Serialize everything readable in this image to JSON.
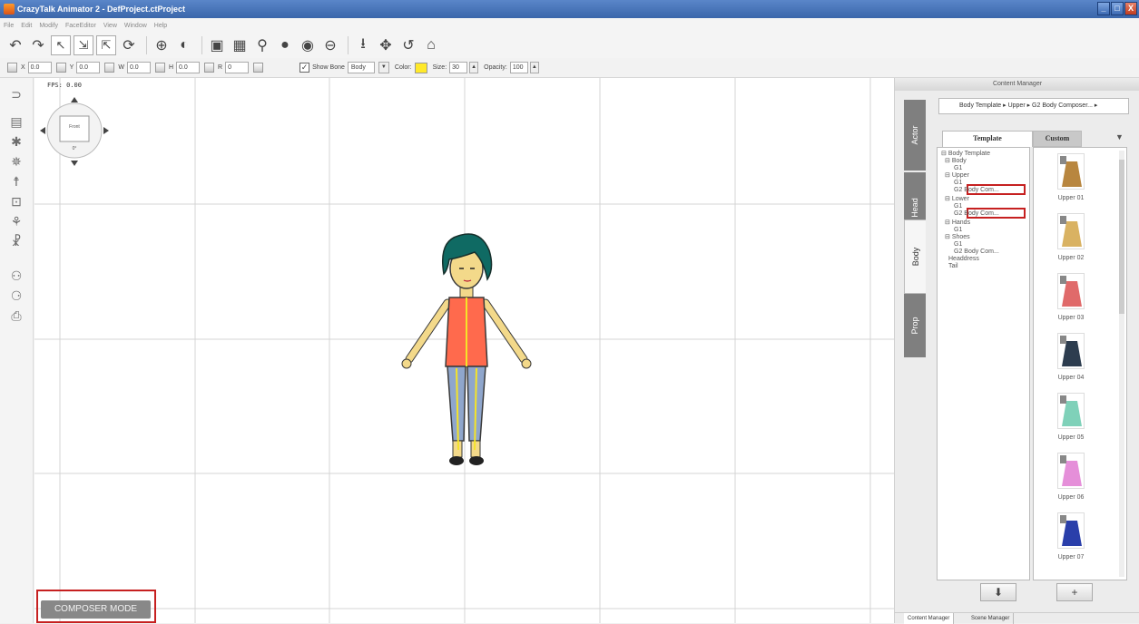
{
  "window": {
    "title": "CrazyTalk Animator 2 - DefProject.ctProject",
    "buttons": [
      "_",
      "□",
      "X"
    ]
  },
  "menu": [
    "File",
    "Edit",
    "Modify",
    "FaceEditor",
    "View",
    "Window",
    "Help"
  ],
  "toolbar": {
    "icons": [
      "undo-icon",
      "redo-icon",
      "select-icon",
      "multi-select-icon",
      "bone-select-icon",
      "rotate-icon",
      "add-actor-icon",
      "add-prop-icon",
      "stage-icon",
      "scene-icon",
      "puppet-icon",
      "sprite-icon",
      "eye-icon",
      "mouth-icon",
      "move-down-icon",
      "move-icon",
      "rotate-back-icon",
      "home-icon"
    ]
  },
  "properties": {
    "x_label": "X",
    "x_value": "0.0",
    "y_label": "Y",
    "y_value": "0.0",
    "w_label": "W",
    "w_value": "0.0",
    "h_label": "H",
    "h_value": "0.0",
    "r_label": "R",
    "r_value": "0",
    "show_bone_label": "Show Bone",
    "show_bone_target": "Body",
    "color_label": "Color:",
    "color_value": "#ffe92a",
    "size_label": "Size:",
    "size_value": "30",
    "opacity_label": "Opacity:",
    "opacity_value": "100"
  },
  "viewport": {
    "fps_label": "FPS: 0.00",
    "camera_label": "Front",
    "camera_angle": "0°",
    "composer_mode_label": "COMPOSER MODE"
  },
  "content_manager": {
    "title": "Content Manager",
    "side_tabs": [
      "Actor",
      "Head",
      "Body",
      "Prop"
    ],
    "active_side_tab": "Body",
    "breadcrumb": "Body Template ▸ Upper ▸ G2 Body Composer... ▸",
    "tabs": [
      "Template",
      "Custom"
    ],
    "active_tab": "Template",
    "tree": [
      {
        "label": "Body Template",
        "indent": 0,
        "prefix": "⊟"
      },
      {
        "label": "Body",
        "indent": 1,
        "prefix": "⊟"
      },
      {
        "label": "G1",
        "indent": 2,
        "prefix": ""
      },
      {
        "label": "Upper",
        "indent": 1,
        "prefix": "⊟"
      },
      {
        "label": "G1",
        "indent": 2,
        "prefix": ""
      },
      {
        "label": "G2 Body Com...",
        "indent": 2,
        "prefix": ""
      },
      {
        "label": "Lower",
        "indent": 1,
        "prefix": "⊟"
      },
      {
        "label": "G1",
        "indent": 2,
        "prefix": ""
      },
      {
        "label": "G2 Body Com...",
        "indent": 2,
        "prefix": ""
      },
      {
        "label": "Hands",
        "indent": 1,
        "prefix": "⊟"
      },
      {
        "label": "G1",
        "indent": 2,
        "prefix": ""
      },
      {
        "label": "Shoes",
        "indent": 1,
        "prefix": "⊟"
      },
      {
        "label": "G1",
        "indent": 2,
        "prefix": ""
      },
      {
        "label": "G2 Body Com...",
        "indent": 2,
        "prefix": ""
      },
      {
        "label": "Headdress",
        "indent": 1,
        "prefix": ""
      },
      {
        "label": "Tail",
        "indent": 1,
        "prefix": ""
      }
    ],
    "thumbnails": [
      {
        "label": "Upper 01",
        "color": "#b8863f"
      },
      {
        "label": "Upper 02",
        "color": "#d9b262"
      },
      {
        "label": "Upper 03",
        "color": "#e06a6a"
      },
      {
        "label": "Upper 04",
        "color": "#2d3d4f"
      },
      {
        "label": "Upper 05",
        "color": "#7fd1b9"
      },
      {
        "label": "Upper 06",
        "color": "#e58fd9"
      },
      {
        "label": "Upper 07",
        "color": "#2a3faa"
      }
    ],
    "action_buttons": [
      "⬇",
      "+"
    ],
    "bottom_tabs": [
      "Content Manager",
      "Scene Manager"
    ]
  }
}
